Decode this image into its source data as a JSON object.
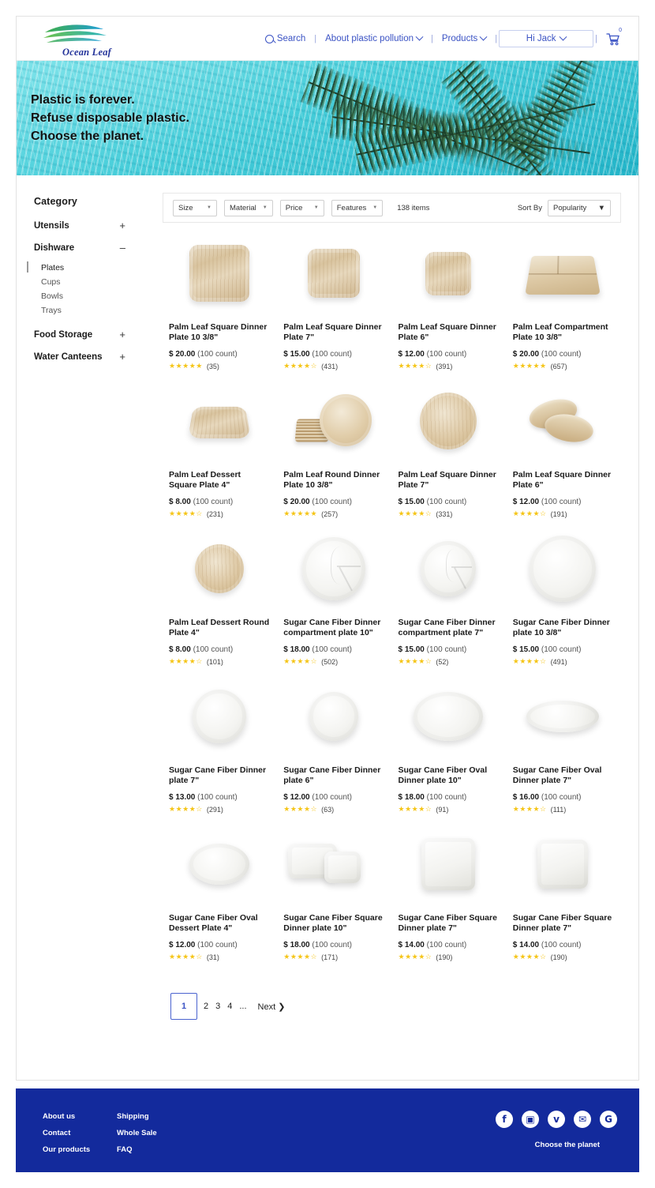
{
  "brand": {
    "name": "Ocean Leaf",
    "logo_icon": "wave-leaf-logo"
  },
  "nav": {
    "search": "Search",
    "about": "About plastic pollution",
    "products": "Products",
    "user": "Hi Jack",
    "cart_count": "0",
    "separator": "|"
  },
  "hero": {
    "line1": "Plastic is forever.",
    "line2": "Refuse disposable plastic.",
    "line3": "Choose the planet."
  },
  "sidebar": {
    "title": "Category",
    "categories": [
      {
        "label": "Utensils",
        "sign": "+"
      },
      {
        "label": "Dishware",
        "sign": "–"
      },
      {
        "label": "Food Storage",
        "sign": "+"
      },
      {
        "label": "Water Canteens",
        "sign": "+"
      }
    ],
    "subcategories": [
      {
        "label": "Plates",
        "active": true
      },
      {
        "label": "Cups",
        "active": false
      },
      {
        "label": "Bowls",
        "active": false
      },
      {
        "label": "Trays",
        "active": false
      }
    ]
  },
  "filters": {
    "size": "Size",
    "material": "Material",
    "price": "Price",
    "features": "Features",
    "item_count": "138 items",
    "sort_label": "Sort By",
    "sort_value": "Popularity",
    "arrow": "▼"
  },
  "products": [
    {
      "title": "Palm Leaf Square Dinner Plate  10 3/8\"",
      "price": "$ 20.00",
      "count": "(100 count)",
      "stars": "★★★★★",
      "reviews": "(35)",
      "art": "sq-palm"
    },
    {
      "title": "Palm Leaf Square Dinner Plate  7\"",
      "price": "$ 15.00",
      "count": "(100 count)",
      "stars": "★★★★☆",
      "reviews": "(431)",
      "art": "sq-palm-m"
    },
    {
      "title": "Palm Leaf Square Dinner Plate  6\"",
      "price": "$ 12.00",
      "count": "(100 count)",
      "stars": "★★★★☆",
      "reviews": "(391)",
      "art": "sq-palm-s"
    },
    {
      "title": "Palm Leaf Compartment Plate  10 3/8\"",
      "price": "$ 20.00",
      "count": "(100 count)",
      "stars": "★★★★★",
      "reviews": "(657)",
      "art": "comp-tray"
    },
    {
      "title": "Palm Leaf Dessert Square Plate  4\"",
      "price": "$ 8.00",
      "count": "(100 count)",
      "stars": "★★★★☆",
      "reviews": "(231)",
      "art": "sq-dessert"
    },
    {
      "title": "Palm Leaf Round Dinner Plate  10 3/8\"",
      "price": "$ 20.00",
      "count": "(100 count)",
      "stars": "★★★★★",
      "reviews": "(257)",
      "art": "stack"
    },
    {
      "title": "Palm Leaf Square Dinner Plate  7\"",
      "price": "$ 15.00",
      "count": "(100 count)",
      "stars": "★★★★☆",
      "reviews": "(331)",
      "art": "rd-palm"
    },
    {
      "title": "Palm Leaf Square Dinner Plate  6\"",
      "price": "$ 12.00",
      "count": "(100 count)",
      "stars": "★★★★☆",
      "reviews": "(191)",
      "art": "tilted"
    },
    {
      "title": "Palm Leaf Dessert Round Plate  4\"",
      "price": "$ 8.00",
      "count": "(100 count)",
      "stars": "★★★★☆",
      "reviews": "(101)",
      "art": "rd-dessert"
    },
    {
      "title": "Sugar Cane Fiber Dinner compartment plate 10\"",
      "price": "$ 18.00",
      "count": "(100 count)",
      "stars": "★★★★☆",
      "reviews": "(502)",
      "art": "w-comp"
    },
    {
      "title": "Sugar Cane Fiber Dinner compartment plate 7\"",
      "price": "$ 15.00",
      "count": "(100 count)",
      "stars": "★★★★☆",
      "reviews": "(52)",
      "art": "w-comp-s"
    },
    {
      "title": "Sugar Cane Fiber Dinner plate 10 3/8\"",
      "price": "$ 15.00",
      "count": "(100 count)",
      "stars": "★★★★☆",
      "reviews": "(491)",
      "art": "w-round"
    },
    {
      "title": "Sugar Cane Fiber Dinner plate 7\"",
      "price": "$ 13.00",
      "count": "(100 count)",
      "stars": "★★★★☆",
      "reviews": "(291)",
      "art": "w-round-m"
    },
    {
      "title": "Sugar Cane Fiber Dinner plate 6\"",
      "price": "$ 12.00",
      "count": "(100 count)",
      "stars": "★★★★☆",
      "reviews": "(63)",
      "art": "w-round-s"
    },
    {
      "title": "Sugar Cane Fiber Oval Dinner plate 10\"",
      "price": "$ 18.00",
      "count": "(100 count)",
      "stars": "★★★★☆",
      "reviews": "(91)",
      "art": "w-oval"
    },
    {
      "title": "Sugar Cane Fiber Oval Dinner plate 7\"",
      "price": "$ 16.00",
      "count": "(100 count)",
      "stars": "★★★★☆",
      "reviews": "(111)",
      "art": "w-oval-s"
    },
    {
      "title": "Sugar Cane Fiber Oval Dessert Plate  4\"",
      "price": "$ 12.00",
      "count": "(100 count)",
      "stars": "★★★★☆",
      "reviews": "(31)",
      "art": "w-oval-xs"
    },
    {
      "title": "Sugar Cane Fiber Square Dinner plate 10\"",
      "price": "$ 18.00",
      "count": "(100 count)",
      "stars": "★★★★☆",
      "reviews": "(171)",
      "art": "w-sq-pair"
    },
    {
      "title": "Sugar Cane Fiber Square Dinner plate 7\"",
      "price": "$ 14.00",
      "count": "(100 count)",
      "stars": "★★★★☆",
      "reviews": "(190)",
      "art": "w-sq"
    },
    {
      "title": "Sugar Cane Fiber Square Dinner plate 7\"",
      "price": "$ 14.00",
      "count": "(100 count)",
      "stars": "★★★★☆",
      "reviews": "(190)",
      "art": "w-sq2"
    }
  ],
  "pagination": {
    "current": "1",
    "pages": [
      "2",
      "3",
      "4"
    ],
    "ellipsis": "...",
    "next": "Next ❯"
  },
  "footer": {
    "col1": [
      "About us",
      "Contact",
      "Our products"
    ],
    "col2": [
      "Shipping",
      "Whole Sale",
      "FAQ"
    ],
    "social": [
      {
        "name": "facebook-icon",
        "glyph": "f"
      },
      {
        "name": "instagram-icon",
        "glyph": "▣"
      },
      {
        "name": "twitter-icon",
        "glyph": "ᴠ"
      },
      {
        "name": "email-icon",
        "glyph": "✉"
      },
      {
        "name": "google-plus-icon",
        "glyph": "G"
      }
    ],
    "tagline": "Choose the planet"
  },
  "colors": {
    "brand_blue": "#132a9c",
    "link_blue": "#3b53c4",
    "star_gold": "#f5c518",
    "hero_water": "#46cdd9"
  }
}
